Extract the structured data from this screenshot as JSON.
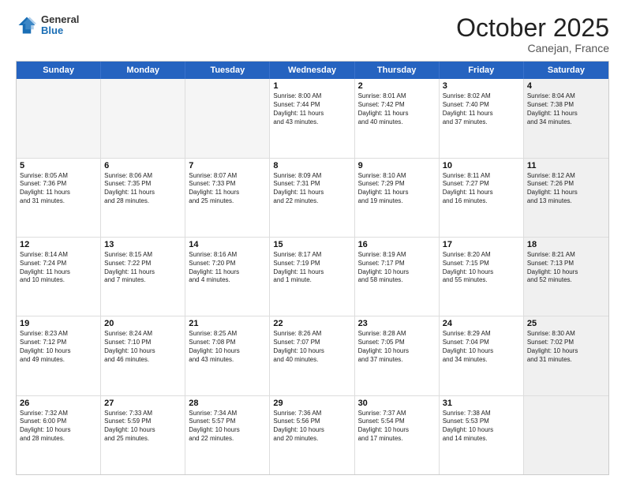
{
  "header": {
    "logo": {
      "general": "General",
      "blue": "Blue"
    },
    "title": "October 2025",
    "location": "Canejan, France"
  },
  "weekdays": [
    "Sunday",
    "Monday",
    "Tuesday",
    "Wednesday",
    "Thursday",
    "Friday",
    "Saturday"
  ],
  "rows": [
    [
      {
        "day": "",
        "text": "",
        "empty": true
      },
      {
        "day": "",
        "text": "",
        "empty": true
      },
      {
        "day": "",
        "text": "",
        "empty": true
      },
      {
        "day": "1",
        "text": "Sunrise: 8:00 AM\nSunset: 7:44 PM\nDaylight: 11 hours\nand 43 minutes."
      },
      {
        "day": "2",
        "text": "Sunrise: 8:01 AM\nSunset: 7:42 PM\nDaylight: 11 hours\nand 40 minutes."
      },
      {
        "day": "3",
        "text": "Sunrise: 8:02 AM\nSunset: 7:40 PM\nDaylight: 11 hours\nand 37 minutes."
      },
      {
        "day": "4",
        "text": "Sunrise: 8:04 AM\nSunset: 7:38 PM\nDaylight: 11 hours\nand 34 minutes.",
        "shaded": true
      }
    ],
    [
      {
        "day": "5",
        "text": "Sunrise: 8:05 AM\nSunset: 7:36 PM\nDaylight: 11 hours\nand 31 minutes."
      },
      {
        "day": "6",
        "text": "Sunrise: 8:06 AM\nSunset: 7:35 PM\nDaylight: 11 hours\nand 28 minutes."
      },
      {
        "day": "7",
        "text": "Sunrise: 8:07 AM\nSunset: 7:33 PM\nDaylight: 11 hours\nand 25 minutes."
      },
      {
        "day": "8",
        "text": "Sunrise: 8:09 AM\nSunset: 7:31 PM\nDaylight: 11 hours\nand 22 minutes."
      },
      {
        "day": "9",
        "text": "Sunrise: 8:10 AM\nSunset: 7:29 PM\nDaylight: 11 hours\nand 19 minutes."
      },
      {
        "day": "10",
        "text": "Sunrise: 8:11 AM\nSunset: 7:27 PM\nDaylight: 11 hours\nand 16 minutes."
      },
      {
        "day": "11",
        "text": "Sunrise: 8:12 AM\nSunset: 7:26 PM\nDaylight: 11 hours\nand 13 minutes.",
        "shaded": true
      }
    ],
    [
      {
        "day": "12",
        "text": "Sunrise: 8:14 AM\nSunset: 7:24 PM\nDaylight: 11 hours\nand 10 minutes."
      },
      {
        "day": "13",
        "text": "Sunrise: 8:15 AM\nSunset: 7:22 PM\nDaylight: 11 hours\nand 7 minutes."
      },
      {
        "day": "14",
        "text": "Sunrise: 8:16 AM\nSunset: 7:20 PM\nDaylight: 11 hours\nand 4 minutes."
      },
      {
        "day": "15",
        "text": "Sunrise: 8:17 AM\nSunset: 7:19 PM\nDaylight: 11 hours\nand 1 minute."
      },
      {
        "day": "16",
        "text": "Sunrise: 8:19 AM\nSunset: 7:17 PM\nDaylight: 10 hours\nand 58 minutes."
      },
      {
        "day": "17",
        "text": "Sunrise: 8:20 AM\nSunset: 7:15 PM\nDaylight: 10 hours\nand 55 minutes."
      },
      {
        "day": "18",
        "text": "Sunrise: 8:21 AM\nSunset: 7:13 PM\nDaylight: 10 hours\nand 52 minutes.",
        "shaded": true
      }
    ],
    [
      {
        "day": "19",
        "text": "Sunrise: 8:23 AM\nSunset: 7:12 PM\nDaylight: 10 hours\nand 49 minutes."
      },
      {
        "day": "20",
        "text": "Sunrise: 8:24 AM\nSunset: 7:10 PM\nDaylight: 10 hours\nand 46 minutes."
      },
      {
        "day": "21",
        "text": "Sunrise: 8:25 AM\nSunset: 7:08 PM\nDaylight: 10 hours\nand 43 minutes."
      },
      {
        "day": "22",
        "text": "Sunrise: 8:26 AM\nSunset: 7:07 PM\nDaylight: 10 hours\nand 40 minutes."
      },
      {
        "day": "23",
        "text": "Sunrise: 8:28 AM\nSunset: 7:05 PM\nDaylight: 10 hours\nand 37 minutes."
      },
      {
        "day": "24",
        "text": "Sunrise: 8:29 AM\nSunset: 7:04 PM\nDaylight: 10 hours\nand 34 minutes."
      },
      {
        "day": "25",
        "text": "Sunrise: 8:30 AM\nSunset: 7:02 PM\nDaylight: 10 hours\nand 31 minutes.",
        "shaded": true
      }
    ],
    [
      {
        "day": "26",
        "text": "Sunrise: 7:32 AM\nSunset: 6:00 PM\nDaylight: 10 hours\nand 28 minutes."
      },
      {
        "day": "27",
        "text": "Sunrise: 7:33 AM\nSunset: 5:59 PM\nDaylight: 10 hours\nand 25 minutes."
      },
      {
        "day": "28",
        "text": "Sunrise: 7:34 AM\nSunset: 5:57 PM\nDaylight: 10 hours\nand 22 minutes."
      },
      {
        "day": "29",
        "text": "Sunrise: 7:36 AM\nSunset: 5:56 PM\nDaylight: 10 hours\nand 20 minutes."
      },
      {
        "day": "30",
        "text": "Sunrise: 7:37 AM\nSunset: 5:54 PM\nDaylight: 10 hours\nand 17 minutes."
      },
      {
        "day": "31",
        "text": "Sunrise: 7:38 AM\nSunset: 5:53 PM\nDaylight: 10 hours\nand 14 minutes."
      },
      {
        "day": "",
        "text": "",
        "empty": true,
        "shaded": true
      }
    ]
  ]
}
